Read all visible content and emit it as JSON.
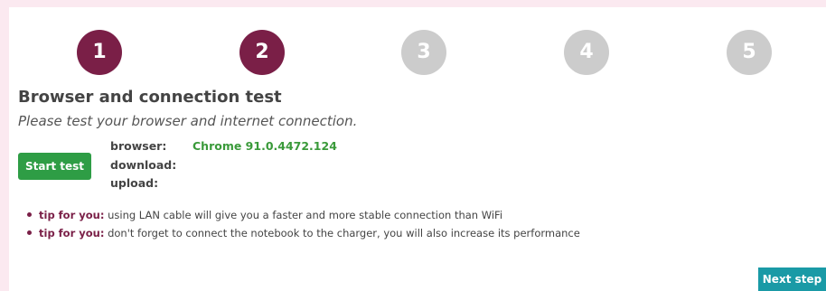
{
  "steps": [
    {
      "number": "1",
      "state": "active"
    },
    {
      "number": "2",
      "state": "active"
    },
    {
      "number": "3",
      "state": "inactive"
    },
    {
      "number": "4",
      "state": "inactive"
    },
    {
      "number": "5",
      "state": "inactive"
    }
  ],
  "section": {
    "title": "Browser and connection test",
    "subtitle": "Please test your browser and internet connection."
  },
  "test": {
    "start_button": "Start test",
    "browser_label": "browser:",
    "browser_value": "Chrome 91.0.4472.124",
    "download_label": "download:",
    "download_value": "",
    "upload_label": "upload:",
    "upload_value": ""
  },
  "tips": [
    {
      "label": "tip for you:",
      "text": " using LAN cable will give you a faster and more stable connection than WiFi"
    },
    {
      "label": "tip for you:",
      "text": " don't forget to connect the notebook to the charger, you will also increase its performance"
    }
  ],
  "footer": {
    "next_button": "Next step"
  },
  "colors": {
    "page_background": "#fbe9f0",
    "step_active": "#7a1f47",
    "step_inactive": "#cccccc",
    "start_button": "#2e9d45",
    "browser_value": "#3a9a3a",
    "next_button": "#1a9aa6"
  }
}
